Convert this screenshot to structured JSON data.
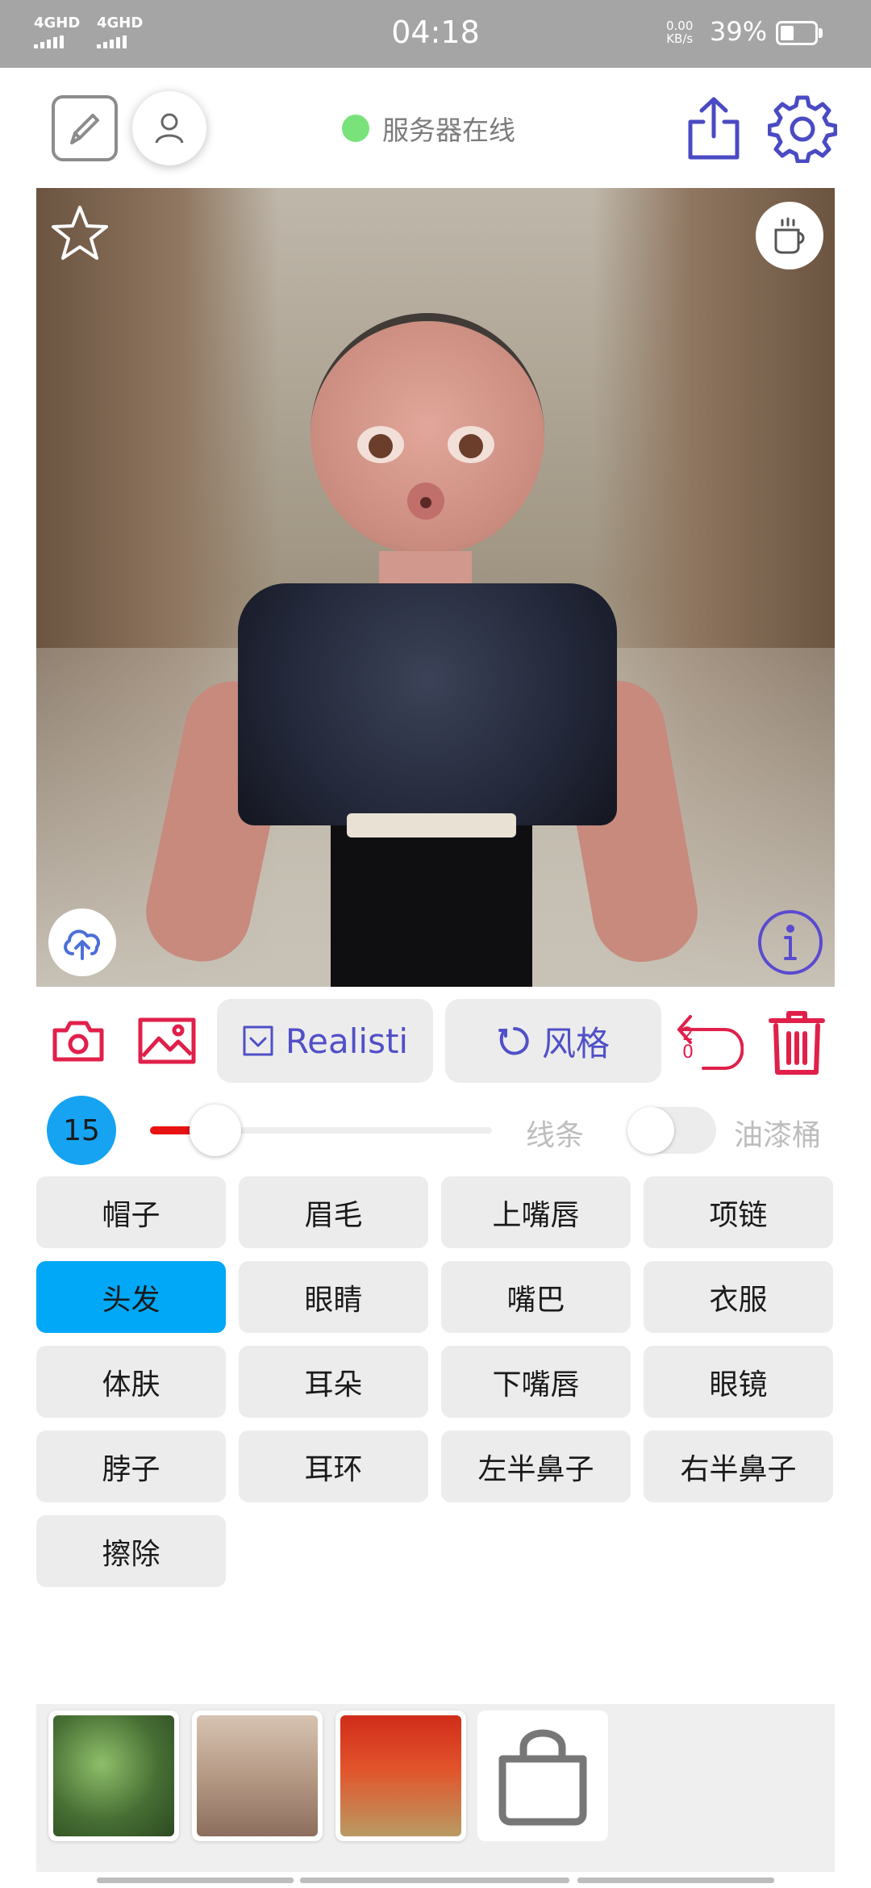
{
  "status_bar": {
    "signal_1": "4GHD",
    "signal_2": "4GHD",
    "time": "04:18",
    "net_speed_value": "0.00",
    "net_speed_unit": "KB/s",
    "battery_percent": "39%",
    "battery_level": 0.39
  },
  "header": {
    "server_status": "服务器在线",
    "server_status_color": "#79e27a",
    "icons": [
      "edit-icon",
      "profile-icon",
      "share-icon",
      "gear-icon"
    ],
    "accent_color": "#4a4ac4"
  },
  "canvas": {
    "corner_icons": [
      "star-icon",
      "coffee-cup-icon",
      "cloud-upload-icon",
      "info-icon"
    ]
  },
  "toolbar": {
    "model_label": "Realisti",
    "style_label": "风格",
    "undo_count_top": "2",
    "undo_count_bottom": "0",
    "icons": [
      "camera-icon",
      "image-icon",
      "checkbox-icon",
      "refresh-icon",
      "undo-icon",
      "trash-icon"
    ],
    "danger_color": "#e0204a"
  },
  "brush": {
    "size": "15",
    "size_fraction": 0.19,
    "line_mode_label": "线条",
    "bucket_label": "油漆桶",
    "bucket_enabled": false
  },
  "categories": [
    {
      "label": "帽子"
    },
    {
      "label": "眉毛"
    },
    {
      "label": "上嘴唇"
    },
    {
      "label": "项链"
    },
    {
      "label": "头发",
      "selected": true
    },
    {
      "label": "眼睛"
    },
    {
      "label": "嘴巴"
    },
    {
      "label": "衣服"
    },
    {
      "label": "体肤"
    },
    {
      "label": "耳朵"
    },
    {
      "label": "下嘴唇"
    },
    {
      "label": "眼镜"
    },
    {
      "label": "脖子"
    },
    {
      "label": "耳环"
    },
    {
      "label": "左半鼻子"
    },
    {
      "label": "右半鼻子"
    },
    {
      "label": "擦除"
    }
  ],
  "tray": {
    "thumbnails": [
      "style-thumbnail-1",
      "style-thumbnail-2",
      "style-thumbnail-3"
    ],
    "shop_icon": "shopping-bag-icon"
  }
}
